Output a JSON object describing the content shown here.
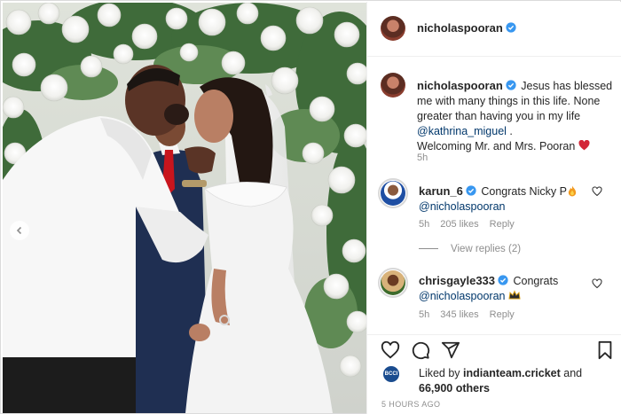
{
  "post": {
    "author": "nicholaspooran",
    "caption_parts": [
      "Jesus has blessed me with many things in this life. None greater than having you in my life ",
      "@kathrina_miguel",
      " .",
      "Welcoming Mr. and Mrs. Pooran "
    ],
    "caption_age": "5h"
  },
  "comments": [
    {
      "username": "karun_6",
      "text_before": "Congrats Nicky P",
      "mention": "@nicholaspooran",
      "age": "5h",
      "likes": "205 likes",
      "reply_label": "Reply",
      "view_replies": "View replies (2)"
    },
    {
      "username": "chrisgayle333",
      "text_before": "Congrats",
      "mention": "@nicholaspooran",
      "age": "5h",
      "likes": "345 likes",
      "reply_label": "Reply"
    }
  ],
  "likes_summary": {
    "prefix": "Liked by ",
    "liker": "indianteam.cricket",
    "middle": " and",
    "others": "66,900 others"
  },
  "timestamp": "5 HOURS AGO",
  "colors": {
    "verified": "#3897f0",
    "mention": "#00376b",
    "heart": "#ed4956",
    "muted": "#8e8e8e"
  },
  "icons": [
    "heart-icon",
    "comment-icon",
    "share-icon",
    "bookmark-icon",
    "verified-badge-icon",
    "chevron-left-icon"
  ]
}
